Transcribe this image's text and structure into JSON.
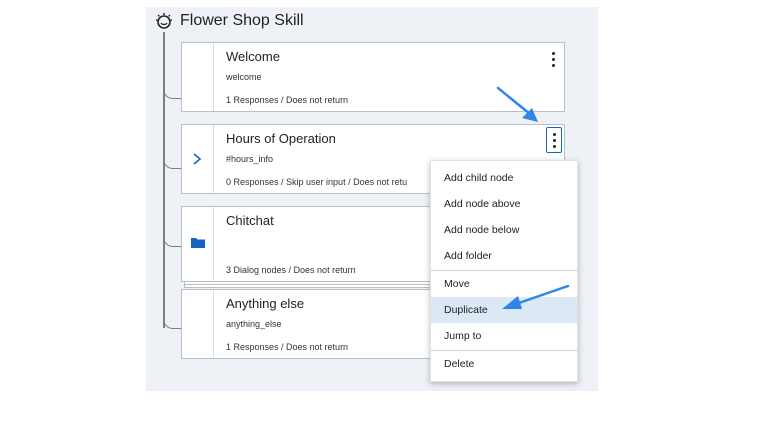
{
  "header": {
    "title": "Flower Shop Skill",
    "icon": "ibm-watson-icon"
  },
  "nodes": [
    {
      "name": "Welcome",
      "condition": "welcome",
      "meta": "1 Responses / Does not return"
    },
    {
      "name": "Hours of Operation",
      "condition": "#hours_info",
      "meta": "0 Responses / Skip user input / Does not retu"
    },
    {
      "name": "Chitchat",
      "condition": "",
      "meta": "3 Dialog nodes / Does not return"
    },
    {
      "name": "Anything else",
      "condition": "anything_else",
      "meta": "1 Responses / Does not return"
    }
  ],
  "menu": {
    "items": [
      "Add child node",
      "Add node above",
      "Add node below",
      "Add folder",
      "Move",
      "Duplicate",
      "Jump to",
      "Delete"
    ],
    "selected": "Duplicate"
  },
  "colors": {
    "accent": "#1565c0",
    "arrow": "#2f86e8",
    "selected_bg": "#dce8f6"
  }
}
